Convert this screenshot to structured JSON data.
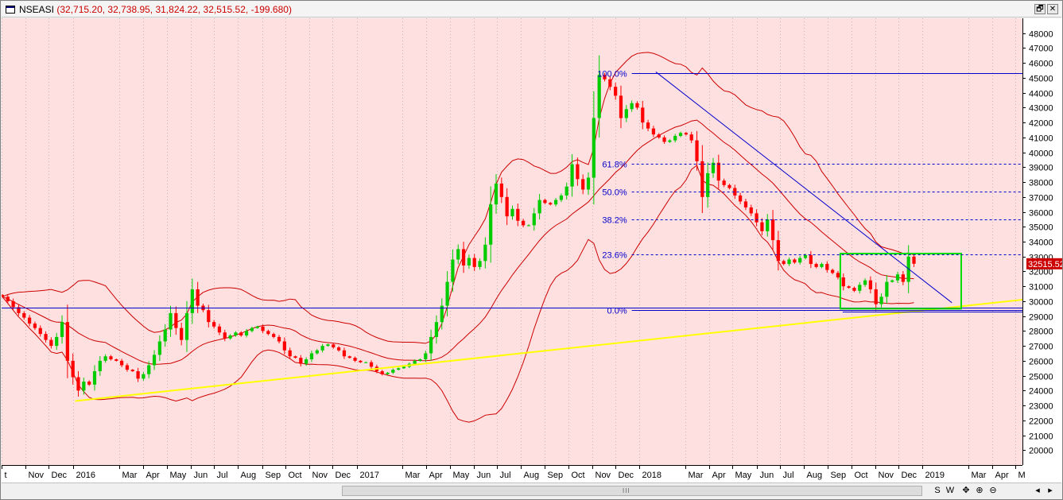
{
  "window": {
    "symbol": "NSEASI",
    "ohlc": "(32,715.20, 32,738.95, 31,824.22, 32,515.52, -199.680)",
    "restore_glyph": "🗗",
    "close_glyph": "✕"
  },
  "bottom_bar": {
    "scroll_grip": "III",
    "buttons": [
      "S",
      "W",
      "✥",
      "⊕",
      "⊖",
      "◂",
      "▸"
    ]
  },
  "colors": {
    "background": "#ffe0e0",
    "up_candle": "#00cc00",
    "down_candle": "#ff0000",
    "bands": "#cc0000",
    "trendline": "#ffff00",
    "fib": "#0000cc",
    "box": "#00dd00",
    "last_price_box": "#cc0000"
  },
  "chart_data": {
    "type": "candlestick",
    "ylim": [
      19000,
      49000
    ],
    "y_ticks": [
      20000,
      21000,
      22000,
      23000,
      24000,
      25000,
      26000,
      27000,
      28000,
      29000,
      30000,
      31000,
      32000,
      33000,
      34000,
      35000,
      36000,
      37000,
      38000,
      39000,
      40000,
      41000,
      42000,
      43000,
      44000,
      45000,
      46000,
      47000,
      48000
    ],
    "x_range": [
      "2015-10-01",
      "2019-05-10"
    ],
    "x_labels": [
      {
        "date": "2015-10-01",
        "label": "t"
      },
      {
        "date": "2015-11-01",
        "label": "Nov"
      },
      {
        "date": "2015-12-01",
        "label": "Dec"
      },
      {
        "date": "2016-01-01",
        "label": "2016"
      },
      {
        "date": "2016-03-01",
        "label": "Mar"
      },
      {
        "date": "2016-04-01",
        "label": "Apr"
      },
      {
        "date": "2016-05-01",
        "label": "May"
      },
      {
        "date": "2016-06-01",
        "label": "Jun"
      },
      {
        "date": "2016-07-01",
        "label": "Jul"
      },
      {
        "date": "2016-08-01",
        "label": "Aug"
      },
      {
        "date": "2016-09-01",
        "label": "Sep"
      },
      {
        "date": "2016-10-01",
        "label": "Oct"
      },
      {
        "date": "2016-11-01",
        "label": "Nov"
      },
      {
        "date": "2016-12-01",
        "label": "Dec"
      },
      {
        "date": "2017-01-01",
        "label": "2017"
      },
      {
        "date": "2017-03-01",
        "label": "Mar"
      },
      {
        "date": "2017-04-01",
        "label": "Apr"
      },
      {
        "date": "2017-05-01",
        "label": "May"
      },
      {
        "date": "2017-06-01",
        "label": "Jun"
      },
      {
        "date": "2017-07-01",
        "label": "Jul"
      },
      {
        "date": "2017-08-01",
        "label": "Aug"
      },
      {
        "date": "2017-09-01",
        "label": "Sep"
      },
      {
        "date": "2017-10-01",
        "label": "Oct"
      },
      {
        "date": "2017-11-01",
        "label": "Nov"
      },
      {
        "date": "2017-12-01",
        "label": "Dec"
      },
      {
        "date": "2018-01-01",
        "label": "2018"
      },
      {
        "date": "2018-03-01",
        "label": "Mar"
      },
      {
        "date": "2018-04-01",
        "label": "Apr"
      },
      {
        "date": "2018-05-01",
        "label": "May"
      },
      {
        "date": "2018-06-01",
        "label": "Jun"
      },
      {
        "date": "2018-07-01",
        "label": "Jul"
      },
      {
        "date": "2018-08-01",
        "label": "Aug"
      },
      {
        "date": "2018-09-01",
        "label": "Sep"
      },
      {
        "date": "2018-10-01",
        "label": "Oct"
      },
      {
        "date": "2018-11-01",
        "label": "Nov"
      },
      {
        "date": "2018-12-01",
        "label": "Dec"
      },
      {
        "date": "2019-01-01",
        "label": "2019"
      },
      {
        "date": "2019-03-01",
        "label": "Mar"
      },
      {
        "date": "2019-04-01",
        "label": "Apr"
      },
      {
        "date": "2019-05-01",
        "label": "M"
      }
    ],
    "grid": "vertical dotted",
    "last_price": {
      "label": "32515.52",
      "value": 32515.52
    },
    "close_series": {
      "start_date": "2015-10-02",
      "step_days": 7,
      "values": [
        30300,
        30000,
        29600,
        29200,
        28900,
        28500,
        28200,
        27800,
        27400,
        27000,
        27600,
        28600,
        26000,
        24900,
        24000,
        24600,
        24400,
        25300,
        26000,
        26300,
        26100,
        26000,
        25700,
        25400,
        25300,
        24800,
        25100,
        25700,
        26400,
        27300,
        28100,
        29200,
        28200,
        27400,
        29200,
        30800,
        29700,
        29400,
        28600,
        28300,
        27900,
        27500,
        27700,
        27900,
        27700,
        28000,
        28200,
        28300,
        28000,
        27800,
        27600,
        27300,
        26700,
        26300,
        26200,
        25800,
        26100,
        26500,
        26700,
        27000,
        27100,
        26900,
        26700,
        26300,
        26200,
        26000,
        25900,
        25900,
        25600,
        25300,
        25100,
        25200,
        25400,
        25500,
        25600,
        25800,
        26000,
        26100,
        26500,
        27600,
        28600,
        29700,
        31300,
        32800,
        33500,
        32400,
        32900,
        32300,
        32700,
        33800,
        36500,
        37900,
        37000,
        35700,
        36200,
        35400,
        35100,
        35100,
        35900,
        36800,
        36600,
        36500,
        36800,
        37100,
        37700,
        39200,
        38200,
        37500,
        38300,
        42300,
        45200,
        44900,
        44400,
        43800,
        42300,
        42900,
        43300,
        43000,
        42000,
        41600,
        41200,
        41000,
        40700,
        40800,
        41100,
        41300,
        41200,
        40800,
        39400,
        37000,
        38600,
        39300,
        38100,
        37800,
        37600,
        37100,
        36700,
        36300,
        35900,
        35300,
        34700,
        35500,
        34100,
        32700,
        32500,
        32800,
        32600,
        32900,
        33100,
        32500,
        32300,
        32500,
        32100,
        31900,
        31600,
        31000,
        30900,
        30700,
        31100,
        31400,
        30800,
        29800,
        30300,
        31300,
        31400,
        31800,
        31300,
        33000,
        32515.52
      ]
    },
    "overlays": [
      {
        "type": "bollinger_bands",
        "period": 20,
        "stddev": 2
      },
      {
        "type": "trendline",
        "from": {
          "date": "2016-01-04",
          "value": 23300
        },
        "to": {
          "date": "2019-05-10",
          "value": 30100
        }
      },
      {
        "type": "trendline",
        "from": {
          "date": "2018-01-22",
          "value": 45400
        },
        "to": {
          "date": "2019-02-08",
          "value": 29900
        }
      },
      {
        "type": "horizontal_line",
        "value": 29550,
        "from_date": "2015-10-01"
      },
      {
        "type": "horizontal_line",
        "value": 29300,
        "from_date": "2018-09-20"
      },
      {
        "type": "rectangle",
        "from": {
          "date": "2018-09-17",
          "value": 29500
        },
        "to": {
          "date": "2019-02-20",
          "value": 33200
        }
      }
    ],
    "fibonacci": {
      "from_date": "2017-12-22",
      "high": 45300,
      "low": 29400,
      "levels": [
        {
          "label": "100.0%",
          "ratio": 1.0,
          "style": "solid"
        },
        {
          "label": "61.8%",
          "ratio": 0.618,
          "style": "dashed"
        },
        {
          "label": "50.0%",
          "ratio": 0.5,
          "style": "dashed"
        },
        {
          "label": "38.2%",
          "ratio": 0.382,
          "style": "dashed"
        },
        {
          "label": "23.6%",
          "ratio": 0.236,
          "style": "dashed"
        },
        {
          "label": "0.0%",
          "ratio": 0.0,
          "style": "solid"
        }
      ]
    }
  }
}
